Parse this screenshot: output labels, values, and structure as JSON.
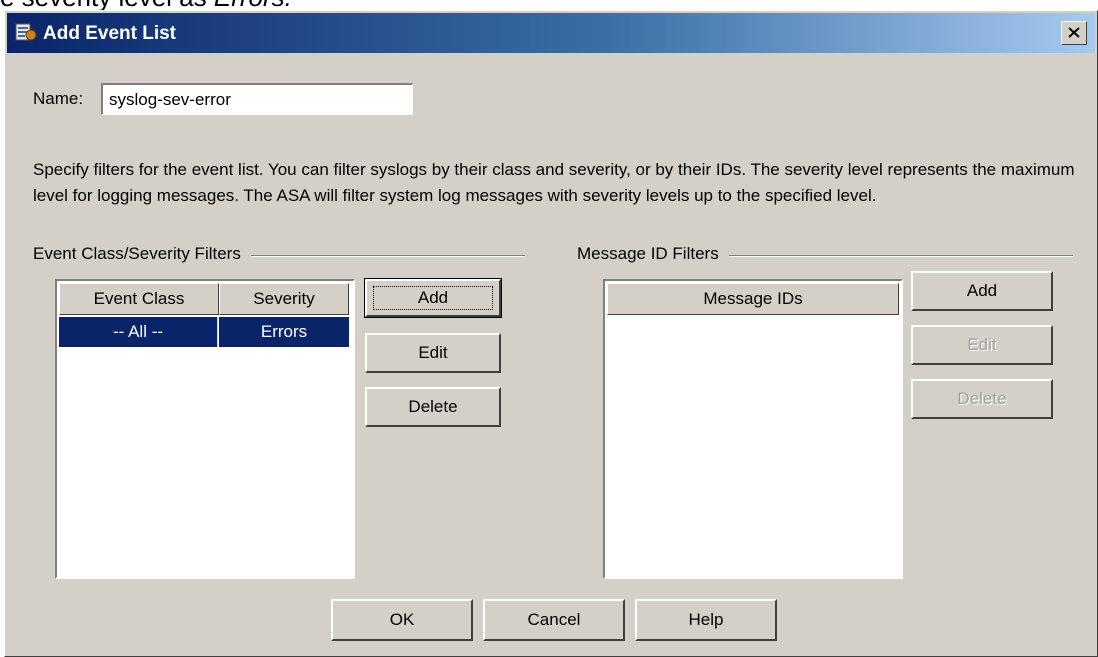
{
  "caption": {
    "prefix": "e severity level as ",
    "emphasis": "Errors."
  },
  "window": {
    "title": "Add Event List",
    "icon": "event-list-icon",
    "close_icon": "close-icon"
  },
  "name_field": {
    "label": "Name:",
    "value": "syslog-sev-error"
  },
  "description": "Specify filters for the event list. You can filter syslogs by their class and severity, or by their IDs. The severity level represents the maximum level for logging messages. The ASA will filter system log messages with severity levels up to the specified level.",
  "event_class_group": {
    "title": "Event Class/Severity Filters",
    "columns": [
      "Event Class",
      "Severity"
    ],
    "rows": [
      {
        "event_class": "-- All --",
        "severity": "Errors",
        "selected": true
      }
    ],
    "buttons": {
      "add": "Add",
      "edit": "Edit",
      "delete": "Delete"
    }
  },
  "message_id_group": {
    "title": "Message ID Filters",
    "columns": [
      "Message IDs"
    ],
    "rows": [],
    "buttons": {
      "add": "Add",
      "edit": "Edit",
      "delete": "Delete"
    },
    "disabled": [
      "edit",
      "delete"
    ]
  },
  "footer": {
    "ok": "OK",
    "cancel": "Cancel",
    "help": "Help"
  },
  "colors": {
    "title_start": "#0a246a",
    "title_end": "#a6caf0",
    "selection": "#0a246a",
    "face": "#d4d0c8"
  }
}
